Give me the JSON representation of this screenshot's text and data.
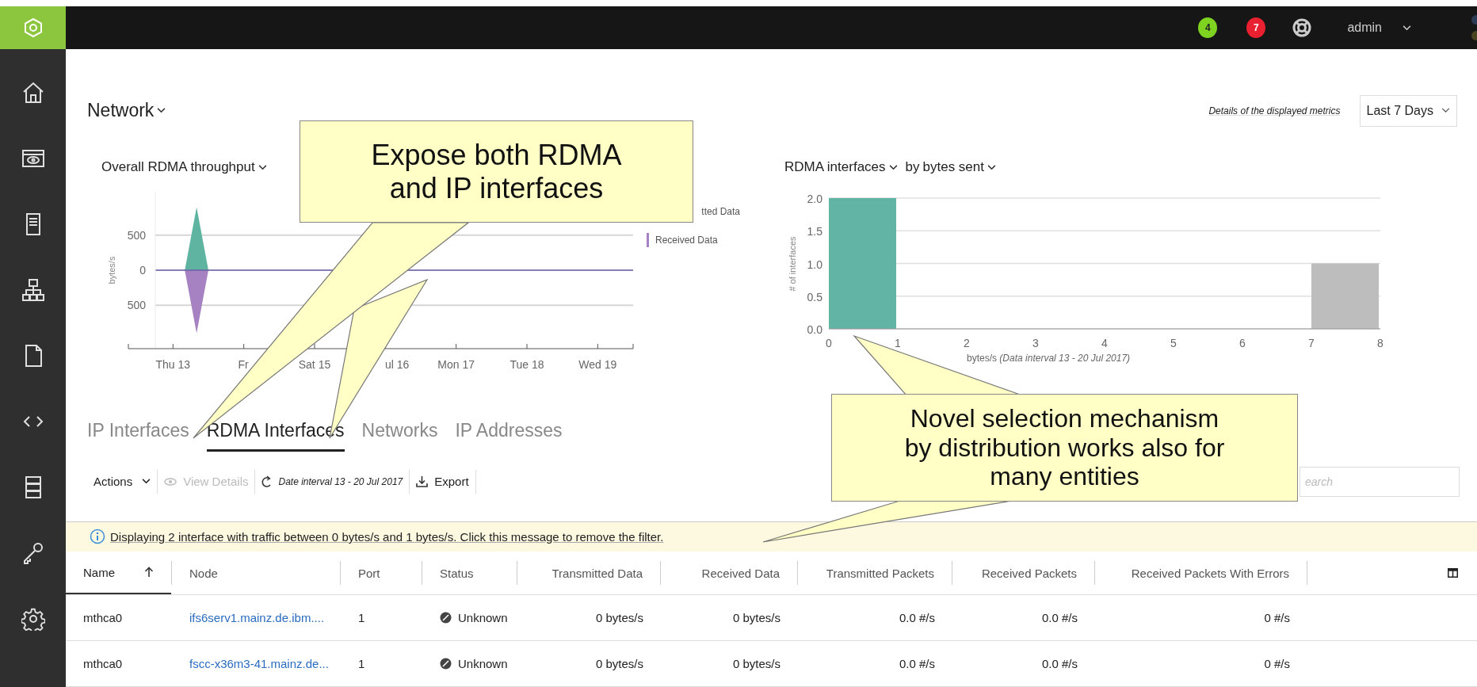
{
  "top_bar": {
    "badges": [
      {
        "text": "4",
        "color": "#7ed321"
      },
      {
        "text": "7",
        "color": "#e8202f"
      }
    ],
    "user": "admin"
  },
  "sidebar": {
    "items": [
      {
        "kind": "home"
      },
      {
        "kind": "monitor"
      },
      {
        "kind": "server"
      },
      {
        "kind": "topology"
      },
      {
        "kind": "file"
      },
      {
        "kind": "code"
      },
      {
        "kind": "storage"
      },
      {
        "kind": "key"
      },
      {
        "kind": "gear"
      }
    ]
  },
  "header": {
    "title": "Network",
    "details_link": "Details of the displayed metrics",
    "range": "Last 7 Days"
  },
  "throughput_chart": {
    "title": "Overall RDMA throughput",
    "chart_data": {
      "type": "area",
      "ylabel": "bytes/s",
      "categories": [
        "Thu 13",
        null,
        null,
        null,
        null,
        null,
        "Fr",
        null,
        null,
        null,
        null,
        null,
        "Sat 15",
        null,
        null,
        null,
        null,
        null,
        "ul 16",
        null,
        null,
        null,
        null,
        null,
        "Mon 17",
        null,
        null,
        null,
        null,
        null,
        "Tue 18",
        null,
        null,
        null,
        null,
        null,
        "Wed 19",
        null,
        null,
        null
      ],
      "series": [
        {
          "name": "tted Data",
          "color": "#5fb3a1",
          "values": [
            0,
            0,
            900,
            0,
            0,
            0,
            0,
            0,
            0,
            0,
            0,
            0,
            0,
            0,
            null,
            null,
            null,
            null,
            null,
            null,
            0,
            0,
            0,
            0,
            0,
            0,
            0,
            0,
            0,
            0,
            0,
            0,
            0,
            0,
            0,
            0,
            0,
            0,
            0,
            0
          ]
        },
        {
          "name": "Received Data",
          "color": "#a782c3",
          "values": [
            0,
            0,
            -900,
            0,
            0,
            0,
            0,
            0,
            0,
            0,
            0,
            0,
            0,
            0,
            null,
            null,
            null,
            null,
            null,
            null,
            0,
            0,
            0,
            0,
            0,
            0,
            0,
            0,
            0,
            0,
            0,
            0,
            0,
            0,
            0,
            0,
            0,
            0,
            0,
            0
          ]
        }
      ],
      "grid": true,
      "ref_lines": [
        {
          "axis": "y",
          "value": 0,
          "color": "#6b5fa8"
        }
      ],
      "ylim": [
        -1120,
        1120
      ],
      "yticks": [
        {
          "value": 500,
          "label": "500"
        },
        {
          "value": 0,
          "label": "0"
        },
        {
          "value": -500,
          "label": "500"
        }
      ]
    }
  },
  "distribution_chart": {
    "entity": "RDMA interfaces",
    "by": "by",
    "metric": "bytes sent",
    "chart_data": {
      "type": "bar",
      "xlabel": "bytes/s *(Data interval 13 - 20 Jul 2017)*",
      "ylabel": "# of interfaces",
      "x": [
        0.5,
        7.5
      ],
      "series": [
        {
          "color": "#62b4a5",
          "values": [
            2,
            null
          ]
        },
        {
          "color": "#bdbdbd",
          "values": [
            null,
            1
          ]
        }
      ],
      "xlim": [
        0,
        8
      ],
      "ylim": [
        0,
        2
      ],
      "grid": true,
      "xticks": [
        0,
        1,
        2,
        3,
        4,
        5,
        6,
        7,
        8
      ],
      "yticks": [
        {
          "value": 0,
          "label": "0.0"
        },
        {
          "value": 0.5,
          "label": "0.5"
        },
        {
          "value": 1,
          "label": "1.0"
        },
        {
          "value": 1.5,
          "label": "1.5"
        },
        {
          "value": 2,
          "label": "2.0"
        }
      ]
    }
  },
  "tabs": [
    {
      "label": "IP Interfaces",
      "selected": false
    },
    {
      "label": "RDMA Interfaces",
      "selected": true
    },
    {
      "label": "Networks",
      "selected": false
    },
    {
      "label": "IP Addresses",
      "selected": false
    }
  ],
  "toolbar": {
    "actions": "Actions",
    "view_details": {
      "label": "View Details",
      "disabled": true
    },
    "interval": "Date interval 13 - 20 Jul 2017",
    "export": "Export",
    "search": {
      "placeholder": "earch"
    }
  },
  "filter_banner": "Displaying 2 interface with traffic between 0 bytes/s and 1 bytes/s. Click this message to remove the filter.",
  "table": {
    "columns": [
      {
        "label": "Name",
        "kind": "text",
        "sorted": true
      },
      {
        "label": "Node",
        "kind": "link",
        "sorted": false
      },
      {
        "label": "Port",
        "kind": "text",
        "sorted": false
      },
      {
        "label": "Status",
        "kind": "status",
        "sorted": false
      },
      {
        "label": "Transmitted Data",
        "kind": "number",
        "sorted": false
      },
      {
        "label": "Received Data",
        "kind": "number",
        "sorted": false
      },
      {
        "label": "Transmitted Packets",
        "kind": "number",
        "sorted": false
      },
      {
        "label": "Received Packets",
        "kind": "number",
        "sorted": false
      },
      {
        "label": "Received Packets With Errors",
        "kind": "number",
        "sorted": false
      }
    ],
    "rows": [
      [
        "mthca0",
        "ifs6serv1.mainz.de.ibm....",
        "1",
        "Unknown",
        "0 bytes/s",
        "0 bytes/s",
        "0.0 #/s",
        "0.0 #/s",
        "0 #/s"
      ],
      [
        "mthca0",
        "fscc-x36m3-41.mainz.de...",
        "1",
        "Unknown",
        "0 bytes/s",
        "0 bytes/s",
        "0.0 #/s",
        "0.0 #/s",
        "0 #/s"
      ]
    ]
  },
  "callouts": [
    {
      "text": "Expose both RDMA\nand IP interfaces"
    },
    {
      "text": "Novel selection mechanism\nby distribution works also for\nmany entities"
    }
  ]
}
